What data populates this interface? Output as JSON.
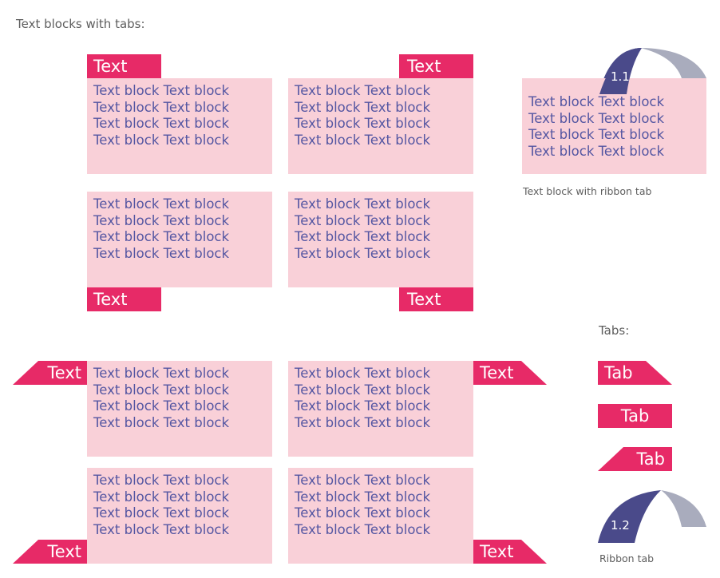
{
  "headings": {
    "main": "Text blocks with tabs:",
    "tabs": "Tabs:"
  },
  "captions": {
    "ribbon_block": "Text block with ribbon tab",
    "ribbon_tab": "Ribbon tab"
  },
  "block_text": {
    "lines": [
      "Text block Text block",
      "Text block Text block",
      "Text block Text block",
      "Text block Text block"
    ]
  },
  "tab_label": "Text",
  "sample_tabs": [
    "Tab",
    "Tab",
    "Tab"
  ],
  "ribbons": {
    "block_ribbon_number": "1.1",
    "standalone_ribbon_number": "1.2"
  },
  "colors": {
    "tab": "#e72a67",
    "block": "#f9d0d8",
    "block_text": "#5456a2",
    "ribbon_front": "#4a4a8a",
    "ribbon_back": "#a9acbd",
    "label": "#5e5e5e"
  }
}
